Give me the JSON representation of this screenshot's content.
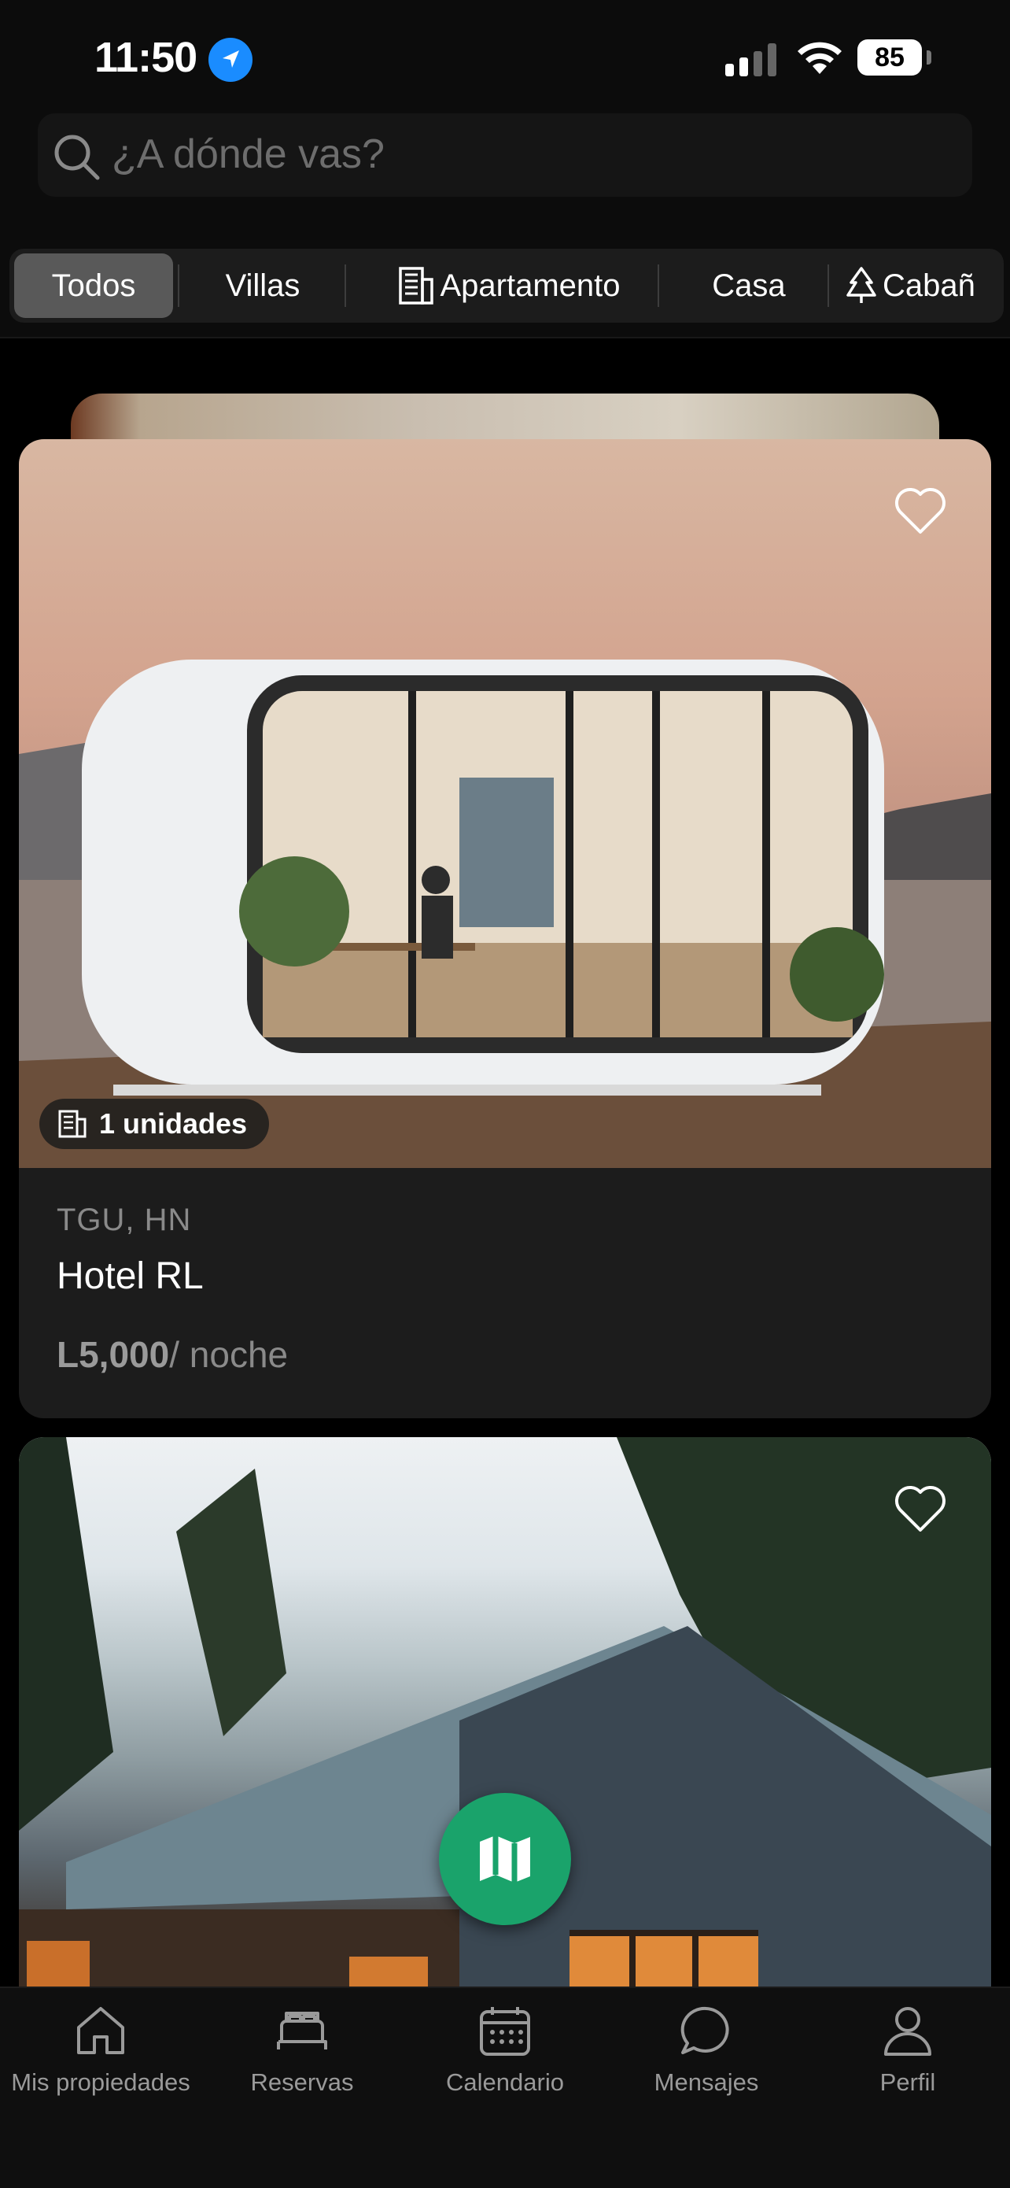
{
  "status": {
    "time": "11:50",
    "battery": "85"
  },
  "search": {
    "placeholder": "¿A dónde vas?"
  },
  "filters": [
    "Todos",
    "Villas",
    "Apartamento",
    "Casa",
    "Cabañ"
  ],
  "listings": [
    {
      "units": "1 unidades",
      "location": "TGU, HN",
      "title": "Hotel RL",
      "price": "L5,000",
      "price_unit": "/ noche"
    }
  ],
  "tabs": [
    "Mis propiedades",
    "Reservas",
    "Calendario",
    "Mensajes",
    "Perfil"
  ],
  "colors": {
    "accent": "#1aa36b",
    "location_blue": "#1a8cff"
  }
}
